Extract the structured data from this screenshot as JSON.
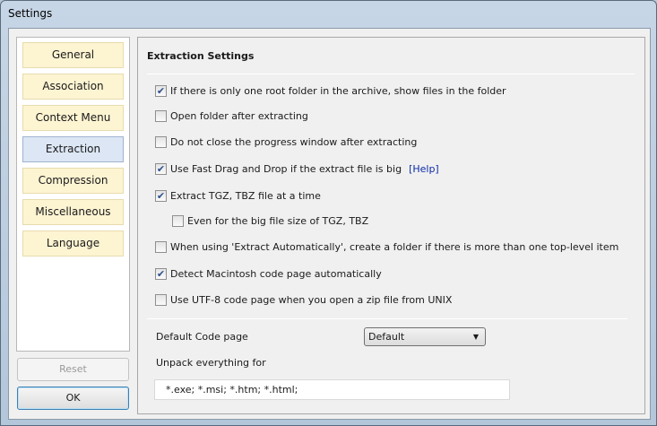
{
  "window": {
    "title": "Settings"
  },
  "sidebar": {
    "items": [
      {
        "label": "General"
      },
      {
        "label": "Association"
      },
      {
        "label": "Context Menu"
      },
      {
        "label": "Extraction",
        "active": true
      },
      {
        "label": "Compression"
      },
      {
        "label": "Miscellaneous"
      },
      {
        "label": "Language"
      }
    ],
    "reset_label": "Reset",
    "ok_label": "OK"
  },
  "main": {
    "heading": "Extraction Settings",
    "options": [
      {
        "label": "If there is only one root folder in the archive, show files in the folder",
        "checked": true
      },
      {
        "label": "Open folder after extracting",
        "checked": false
      },
      {
        "label": "Do not close the progress window after extracting",
        "checked": false
      },
      {
        "label": "Use Fast Drag and Drop if the extract file is big",
        "checked": true,
        "link": "[Help]"
      },
      {
        "label": "Extract TGZ, TBZ file at a time",
        "checked": true
      },
      {
        "label": "Even for the big file size of TGZ, TBZ",
        "checked": false
      },
      {
        "label": "When using 'Extract Automatically', create a folder if there is more than one top-level item",
        "checked": false
      },
      {
        "label": "Detect Macintosh code page automatically",
        "checked": true
      },
      {
        "label": "Use UTF-8 code page when you open a zip file from UNIX",
        "checked": false
      }
    ],
    "code_page_label": "Default Code page",
    "code_page_value": "Default",
    "unpack_label": "Unpack everything for",
    "unpack_value": "*.exe; *.msi; *.htm; *.html;"
  }
}
